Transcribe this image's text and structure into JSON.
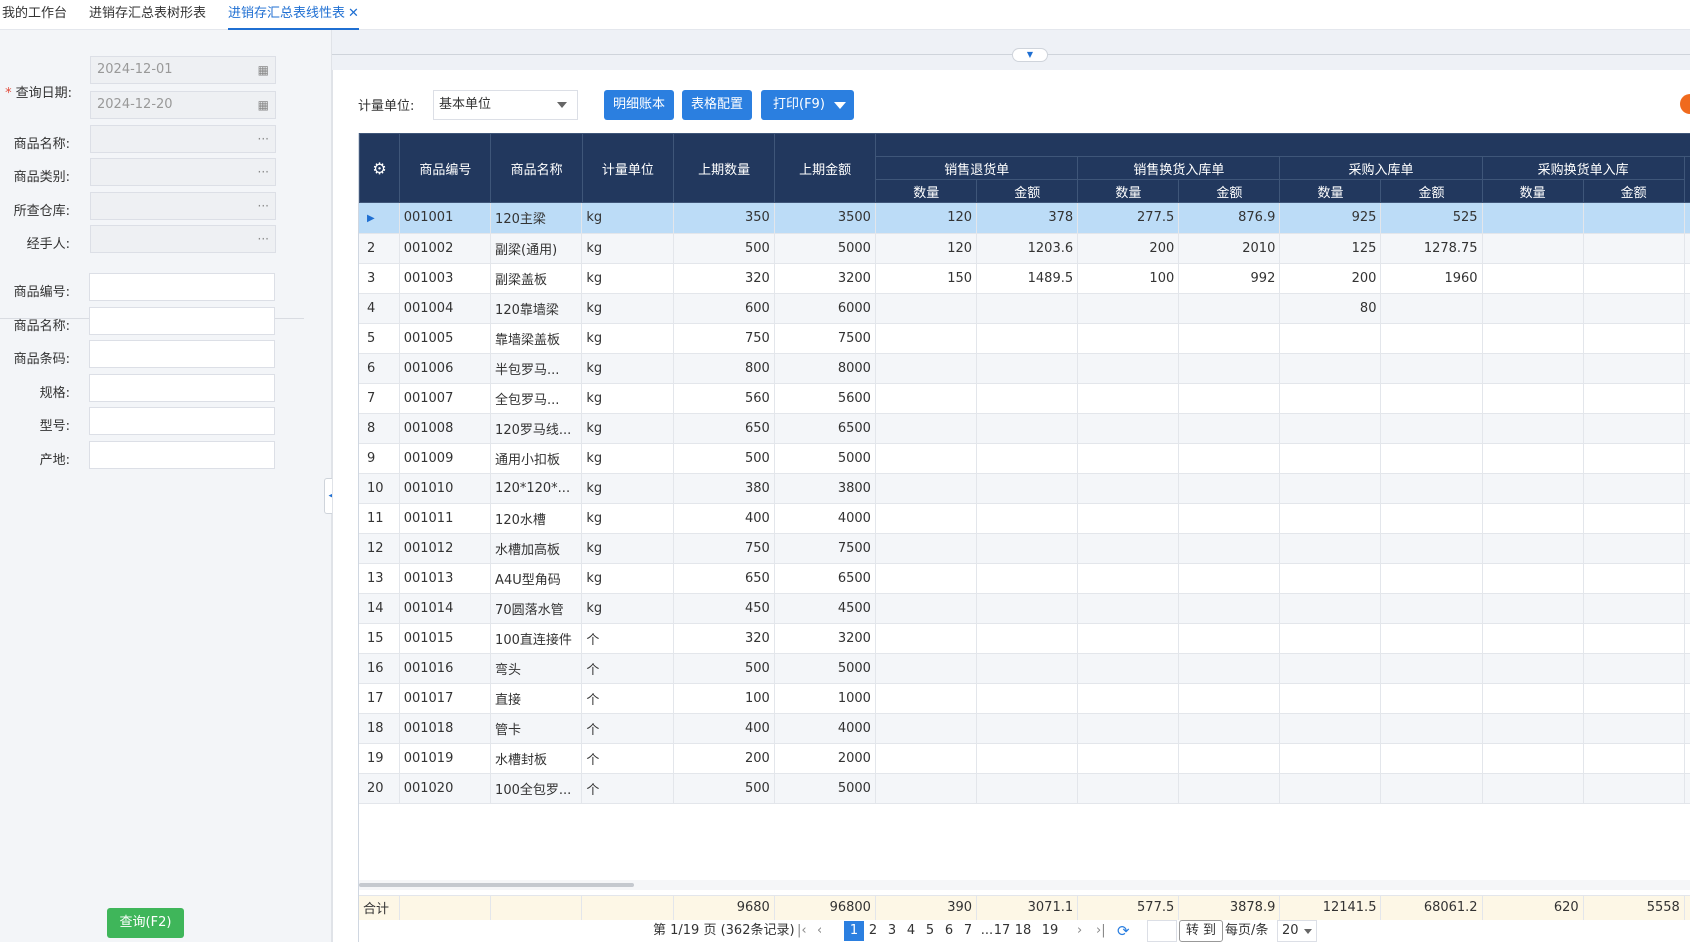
{
  "tabs": [
    {
      "label": "我的工作台"
    },
    {
      "label": "进销存汇总表树形表"
    },
    {
      "label": "进销存汇总表线性表",
      "close": "✕"
    }
  ],
  "filters": {
    "date_label": "查询日期:",
    "date_required_mark": "*",
    "date_start": "2024-12-01",
    "date_end": "2024-12-20",
    "product_name_label": "商品名称:",
    "category_label": "商品类别:",
    "warehouse_label": "所查仓库:",
    "handler_label": "经手人:",
    "more_glyph": "···",
    "code_label": "商品编号:",
    "name_label": "商品名称:",
    "barcode_label": "商品条码:",
    "spec_label": "规格:",
    "model_label": "型号:",
    "origin_label": "产地:",
    "search_button": "查询(F2)"
  },
  "toolbar": {
    "unit_label": "计量单位:",
    "unit_value": "基本单位",
    "detail_button": "明细账本",
    "config_button": "表格配置",
    "print_button": "打印(F9)"
  },
  "table": {
    "headers": {
      "code": "商品编号",
      "name": "商品名称",
      "unit": "计量单位",
      "prev_qty": "上期数量",
      "prev_amt": "上期金额",
      "groups": [
        "销售退货单",
        "销售换货入库单",
        "采购入库单",
        "采购换货单入库"
      ],
      "qty": "数量",
      "amt": "金额"
    },
    "rows": [
      {
        "no": "",
        "code": "001001",
        "name": "120主梁",
        "unit": "kg",
        "prev_qty": "350",
        "prev_amt": "3500",
        "c1": "120",
        "c2": "378",
        "c3": "277.5",
        "c4": "876.9",
        "c5": "925",
        "c6": "525",
        "c7": "",
        "c8": ""
      },
      {
        "no": "2",
        "code": "001002",
        "name": "副梁(通用)",
        "unit": "kg",
        "prev_qty": "500",
        "prev_amt": "5000",
        "c1": "120",
        "c2": "1203.6",
        "c3": "200",
        "c4": "2010",
        "c5": "125",
        "c6": "1278.75",
        "c7": "",
        "c8": ""
      },
      {
        "no": "3",
        "code": "001003",
        "name": "副梁盖板",
        "unit": "kg",
        "prev_qty": "320",
        "prev_amt": "3200",
        "c1": "150",
        "c2": "1489.5",
        "c3": "100",
        "c4": "992",
        "c5": "200",
        "c6": "1960",
        "c7": "",
        "c8": ""
      },
      {
        "no": "4",
        "code": "001004",
        "name": "120靠墙梁",
        "unit": "kg",
        "prev_qty": "600",
        "prev_amt": "6000",
        "c1": "",
        "c2": "",
        "c3": "",
        "c4": "",
        "c5": "80",
        "c6": "",
        "c7": "",
        "c8": ""
      },
      {
        "no": "5",
        "code": "001005",
        "name": "靠墙梁盖板",
        "unit": "kg",
        "prev_qty": "750",
        "prev_amt": "7500",
        "c1": "",
        "c2": "",
        "c3": "",
        "c4": "",
        "c5": "",
        "c6": "",
        "c7": "",
        "c8": ""
      },
      {
        "no": "6",
        "code": "001006",
        "name": "半包罗马...",
        "unit": "kg",
        "prev_qty": "800",
        "prev_amt": "8000",
        "c1": "",
        "c2": "",
        "c3": "",
        "c4": "",
        "c5": "",
        "c6": "",
        "c7": "",
        "c8": ""
      },
      {
        "no": "7",
        "code": "001007",
        "name": "全包罗马...",
        "unit": "kg",
        "prev_qty": "560",
        "prev_amt": "5600",
        "c1": "",
        "c2": "",
        "c3": "",
        "c4": "",
        "c5": "",
        "c6": "",
        "c7": "",
        "c8": ""
      },
      {
        "no": "8",
        "code": "001008",
        "name": "120罗马线...",
        "unit": "kg",
        "prev_qty": "650",
        "prev_amt": "6500",
        "c1": "",
        "c2": "",
        "c3": "",
        "c4": "",
        "c5": "",
        "c6": "",
        "c7": "",
        "c8": ""
      },
      {
        "no": "9",
        "code": "001009",
        "name": "通用小扣板",
        "unit": "kg",
        "prev_qty": "500",
        "prev_amt": "5000",
        "c1": "",
        "c2": "",
        "c3": "",
        "c4": "",
        "c5": "",
        "c6": "",
        "c7": "",
        "c8": ""
      },
      {
        "no": "10",
        "code": "001010",
        "name": "120*120*...",
        "unit": "kg",
        "prev_qty": "380",
        "prev_amt": "3800",
        "c1": "",
        "c2": "",
        "c3": "",
        "c4": "",
        "c5": "",
        "c6": "",
        "c7": "",
        "c8": ""
      },
      {
        "no": "11",
        "code": "001011",
        "name": "120水槽",
        "unit": "kg",
        "prev_qty": "400",
        "prev_amt": "4000",
        "c1": "",
        "c2": "",
        "c3": "",
        "c4": "",
        "c5": "",
        "c6": "",
        "c7": "",
        "c8": ""
      },
      {
        "no": "12",
        "code": "001012",
        "name": "水槽加高板",
        "unit": "kg",
        "prev_qty": "750",
        "prev_amt": "7500",
        "c1": "",
        "c2": "",
        "c3": "",
        "c4": "",
        "c5": "",
        "c6": "",
        "c7": "",
        "c8": ""
      },
      {
        "no": "13",
        "code": "001013",
        "name": "A4U型角码",
        "unit": "kg",
        "prev_qty": "650",
        "prev_amt": "6500",
        "c1": "",
        "c2": "",
        "c3": "",
        "c4": "",
        "c5": "",
        "c6": "",
        "c7": "",
        "c8": ""
      },
      {
        "no": "14",
        "code": "001014",
        "name": "70圆落水管",
        "unit": "kg",
        "prev_qty": "450",
        "prev_amt": "4500",
        "c1": "",
        "c2": "",
        "c3": "",
        "c4": "",
        "c5": "",
        "c6": "",
        "c7": "",
        "c8": ""
      },
      {
        "no": "15",
        "code": "001015",
        "name": "100直连接件",
        "unit": "个",
        "prev_qty": "320",
        "prev_amt": "3200",
        "c1": "",
        "c2": "",
        "c3": "",
        "c4": "",
        "c5": "",
        "c6": "",
        "c7": "",
        "c8": ""
      },
      {
        "no": "16",
        "code": "001016",
        "name": "弯头",
        "unit": "个",
        "prev_qty": "500",
        "prev_amt": "5000",
        "c1": "",
        "c2": "",
        "c3": "",
        "c4": "",
        "c5": "",
        "c6": "",
        "c7": "",
        "c8": ""
      },
      {
        "no": "17",
        "code": "001017",
        "name": "直接",
        "unit": "个",
        "prev_qty": "100",
        "prev_amt": "1000",
        "c1": "",
        "c2": "",
        "c3": "",
        "c4": "",
        "c5": "",
        "c6": "",
        "c7": "",
        "c8": ""
      },
      {
        "no": "18",
        "code": "001018",
        "name": "管卡",
        "unit": "个",
        "prev_qty": "400",
        "prev_amt": "4000",
        "c1": "",
        "c2": "",
        "c3": "",
        "c4": "",
        "c5": "",
        "c6": "",
        "c7": "",
        "c8": ""
      },
      {
        "no": "19",
        "code": "001019",
        "name": "水槽封板",
        "unit": "个",
        "prev_qty": "200",
        "prev_amt": "2000",
        "c1": "",
        "c2": "",
        "c3": "",
        "c4": "",
        "c5": "",
        "c6": "",
        "c7": "",
        "c8": ""
      },
      {
        "no": "20",
        "code": "001020",
        "name": "100全包罗...",
        "unit": "个",
        "prev_qty": "500",
        "prev_amt": "5000",
        "c1": "",
        "c2": "",
        "c3": "",
        "c4": "",
        "c5": "",
        "c6": "",
        "c7": "",
        "c8": ""
      }
    ],
    "summary": {
      "label": "合计",
      "prev_qty": "9680",
      "prev_amt": "96800",
      "c1": "390",
      "c2": "3071.1",
      "c3": "577.5",
      "c4": "3878.9",
      "c5": "12141.5",
      "c6": "68061.2",
      "c7": "620",
      "c8": "5558"
    }
  },
  "pager": {
    "info": "第 1/19 页 (362条记录)",
    "pages": [
      "1",
      "2",
      "3",
      "4",
      "5",
      "6",
      "7",
      "...",
      "17",
      "18",
      "19"
    ],
    "goto_label": "转 到",
    "per_page_label": "每页/条",
    "per_page_value": "20"
  }
}
